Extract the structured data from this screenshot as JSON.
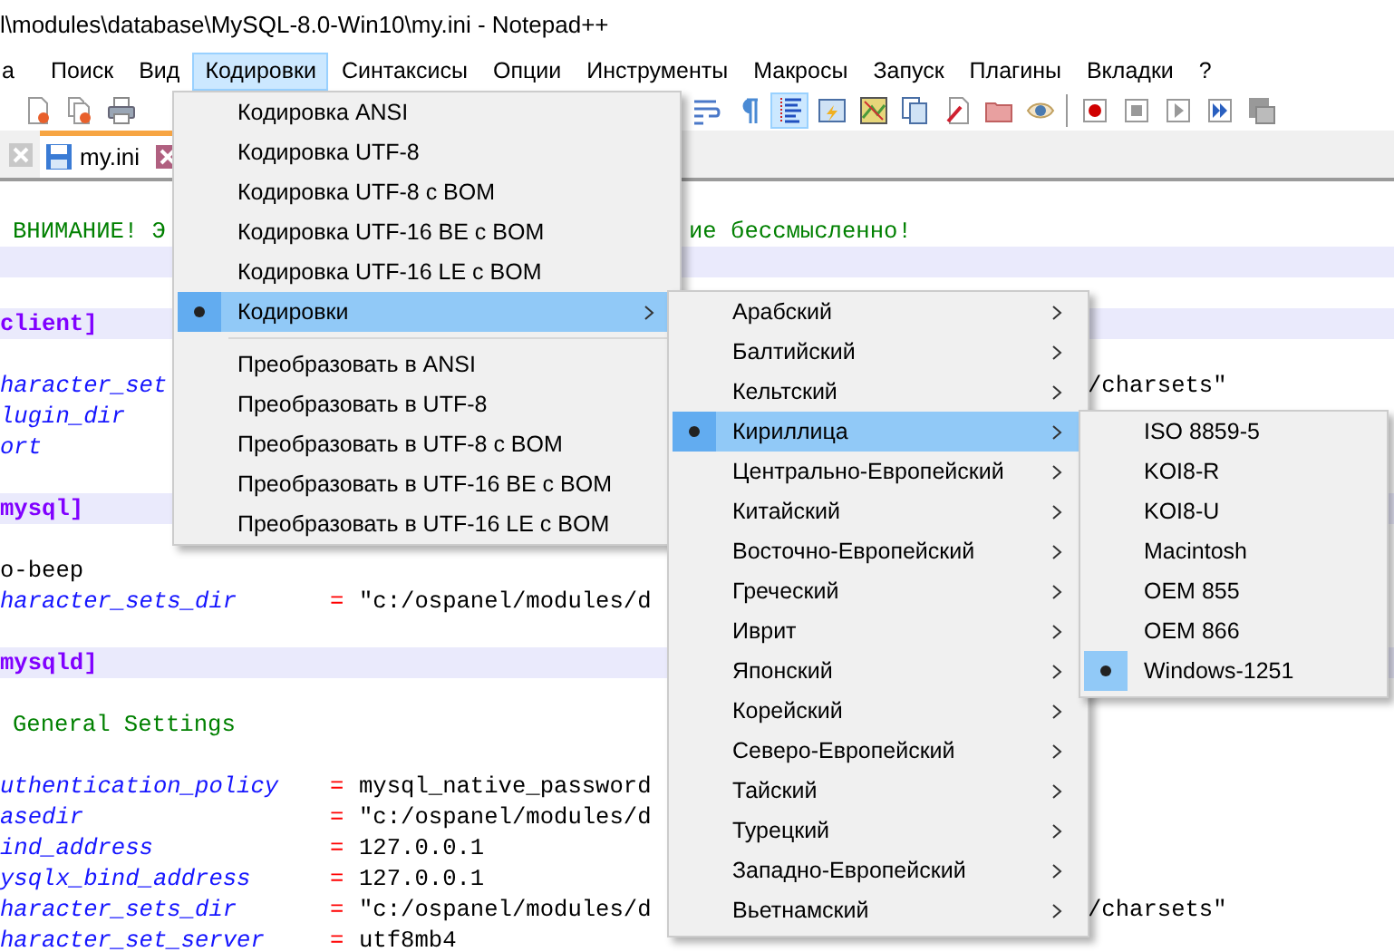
{
  "window": {
    "title": "l\\modules\\database\\MySQL-8.0-Win10\\my.ini - Notepad++"
  },
  "menu_bar": [
    {
      "label": "а",
      "selected": false
    },
    {
      "label": "Поиск",
      "selected": false
    },
    {
      "label": "Вид",
      "selected": false
    },
    {
      "label": "Кодировки",
      "selected": true
    },
    {
      "label": "Синтаксисы",
      "selected": false
    },
    {
      "label": "Опции",
      "selected": false
    },
    {
      "label": "Инструменты",
      "selected": false
    },
    {
      "label": "Макросы",
      "selected": false
    },
    {
      "label": "Запуск",
      "selected": false
    },
    {
      "label": "Плагины",
      "selected": false
    },
    {
      "label": "Вкладки",
      "selected": false
    },
    {
      "label": "?",
      "selected": false
    }
  ],
  "toolbar": {
    "indent_guides_checked": true
  },
  "tabs": [
    {
      "label": "my.ini",
      "selected": true
    }
  ],
  "editor": {
    "lines": [
      {
        "kind": "comment",
        "text": "ВНИМАНИЕ! Э",
        "after_menu": "ие бессмысленно!"
      },
      {
        "kind": "blank",
        "current": true
      },
      {
        "kind": "blank",
        "current": false
      },
      {
        "kind": "section",
        "text": "client]"
      },
      {
        "kind": "blank",
        "current": false
      },
      {
        "kind": "setting",
        "key": "haracter_set",
        "after_submenu": "/charsets\""
      },
      {
        "kind": "setting",
        "key": "lugin_dir"
      },
      {
        "kind": "setting",
        "key": "ort"
      },
      {
        "kind": "blank",
        "current": false
      },
      {
        "kind": "section",
        "text": "mysql]"
      },
      {
        "kind": "blank",
        "current": false
      },
      {
        "kind": "plain",
        "text": "o-beep"
      },
      {
        "kind": "setting",
        "key": "haracter_sets_dir",
        "equals": "=",
        "value": "\"c:/ospanel/modules/d"
      },
      {
        "kind": "blank",
        "current": false
      },
      {
        "kind": "section",
        "text": "mysqld]"
      },
      {
        "kind": "blank",
        "current": false
      },
      {
        "kind": "comment",
        "text": "General Settings"
      },
      {
        "kind": "blank",
        "current": false
      },
      {
        "kind": "setting",
        "key": "uthentication_policy",
        "equals": "=",
        "value": "mysql_native_password"
      },
      {
        "kind": "setting",
        "key": "asedir",
        "equals": "=",
        "value": "\"c:/ospanel/modules/d"
      },
      {
        "kind": "setting",
        "key": "ind_address",
        "equals": "=",
        "value": "127.0.0.1"
      },
      {
        "kind": "setting",
        "key": "ysqlx_bind_address",
        "equals": "=",
        "value": "127.0.0.1"
      },
      {
        "kind": "setting",
        "key": "haracter_sets_dir",
        "equals": "=",
        "value": "\"c:/ospanel/modules/d",
        "after_submenu": "/charsets\""
      },
      {
        "kind": "setting",
        "key": "haracter_set_server",
        "equals": "=",
        "value": "utf8mb4"
      }
    ]
  },
  "encoding_menu": {
    "items": [
      {
        "kind": "item",
        "label": "Кодировка ANSI",
        "checked": false,
        "selected": false
      },
      {
        "kind": "item",
        "label": "Кодировка UTF-8",
        "checked": false,
        "selected": false
      },
      {
        "kind": "item",
        "label": "Кодировка UTF-8 с BOM",
        "checked": false,
        "selected": false
      },
      {
        "kind": "item",
        "label": "Кодировка UTF-16 BE с BOM",
        "checked": false,
        "selected": false
      },
      {
        "kind": "item",
        "label": "Кодировка UTF-16 LE с BOM",
        "checked": false,
        "selected": false
      },
      {
        "kind": "submenu",
        "label": "Кодировки",
        "checked": true,
        "selected": true
      },
      {
        "kind": "separator"
      },
      {
        "kind": "item",
        "label": "Преобразовать в ANSI",
        "checked": false,
        "selected": false
      },
      {
        "kind": "item",
        "label": "Преобразовать в UTF-8",
        "checked": false,
        "selected": false
      },
      {
        "kind": "item",
        "label": "Преобразовать в UTF-8 с BOM",
        "checked": false,
        "selected": false
      },
      {
        "kind": "item",
        "label": "Преобразовать в UTF-16 BE с BOM",
        "checked": false,
        "selected": false
      },
      {
        "kind": "item",
        "label": "Преобразовать в UTF-16 LE с BOM",
        "checked": false,
        "selected": false
      }
    ]
  },
  "charset_submenu": {
    "items": [
      {
        "kind": "submenu",
        "label": "Арабский",
        "checked": false,
        "selected": false
      },
      {
        "kind": "submenu",
        "label": "Балтийский",
        "checked": false,
        "selected": false
      },
      {
        "kind": "submenu",
        "label": "Кельтский",
        "checked": false,
        "selected": false
      },
      {
        "kind": "submenu",
        "label": "Кириллица",
        "checked": true,
        "selected": true
      },
      {
        "kind": "submenu",
        "label": "Центрально-Европейский",
        "checked": false,
        "selected": false
      },
      {
        "kind": "submenu",
        "label": "Китайский",
        "checked": false,
        "selected": false
      },
      {
        "kind": "submenu",
        "label": "Восточно-Европейский",
        "checked": false,
        "selected": false
      },
      {
        "kind": "submenu",
        "label": "Греческий",
        "checked": false,
        "selected": false
      },
      {
        "kind": "submenu",
        "label": "Иврит",
        "checked": false,
        "selected": false
      },
      {
        "kind": "submenu",
        "label": "Японский",
        "checked": false,
        "selected": false
      },
      {
        "kind": "submenu",
        "label": "Корейский",
        "checked": false,
        "selected": false
      },
      {
        "kind": "submenu",
        "label": "Северо-Европейский",
        "checked": false,
        "selected": false
      },
      {
        "kind": "submenu",
        "label": "Тайский",
        "checked": false,
        "selected": false
      },
      {
        "kind": "submenu",
        "label": "Турецкий",
        "checked": false,
        "selected": false
      },
      {
        "kind": "submenu",
        "label": "Западно-Европейский",
        "checked": false,
        "selected": false
      },
      {
        "kind": "submenu",
        "label": "Вьетнамский",
        "checked": false,
        "selected": false
      }
    ]
  },
  "cyrillic_submenu": {
    "items": [
      {
        "kind": "item",
        "label": "ISO 8859-5",
        "checked": false,
        "selected": false
      },
      {
        "kind": "item",
        "label": "KOI8-R",
        "checked": false,
        "selected": false
      },
      {
        "kind": "item",
        "label": "KOI8-U",
        "checked": false,
        "selected": false
      },
      {
        "kind": "item",
        "label": "Macintosh",
        "checked": false,
        "selected": false
      },
      {
        "kind": "item",
        "label": "OEM 855",
        "checked": false,
        "selected": false
      },
      {
        "kind": "item",
        "label": "OEM 866",
        "checked": false,
        "selected": false
      },
      {
        "kind": "item",
        "label": "Windows-1251",
        "checked": true,
        "selected": false
      }
    ]
  }
}
